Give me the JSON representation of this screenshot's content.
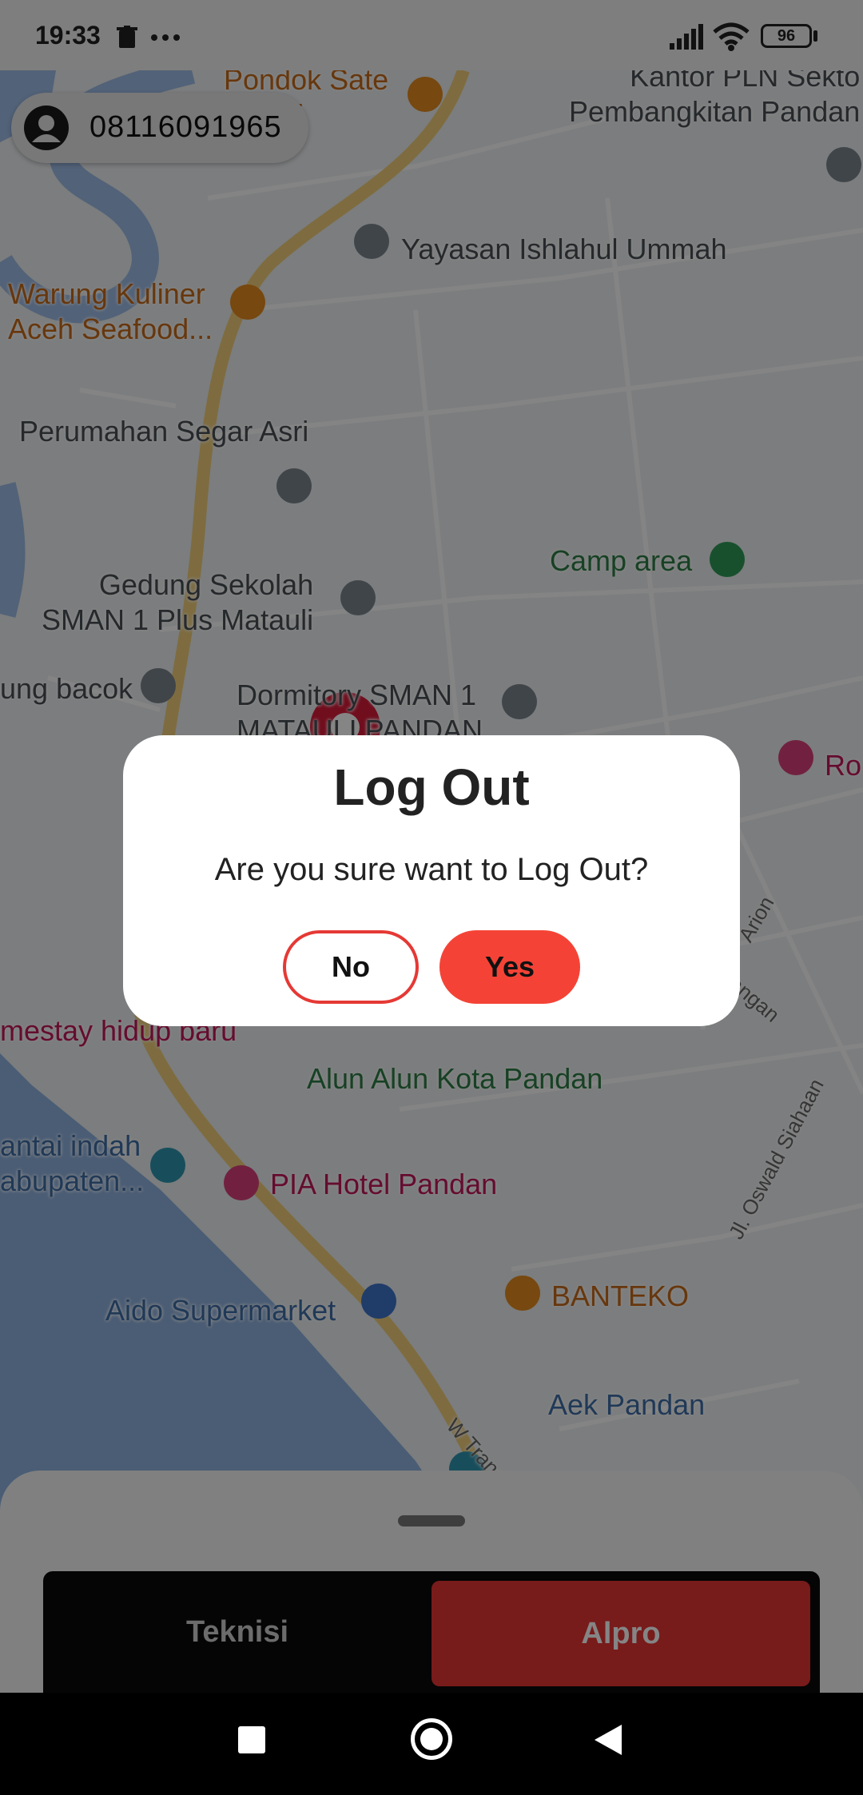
{
  "status_bar": {
    "time": "19:33",
    "battery": "96",
    "icons": [
      "trash-icon",
      "more-dots-icon",
      "signal-icon",
      "wifi-icon",
      "battery-icon"
    ]
  },
  "user": {
    "phone": "08116091965",
    "icon": "account-circle-icon"
  },
  "map": {
    "labels": {
      "pondok_sate": "Pondok Sate\nSubali",
      "kantor_pln": "Kantor PLN Sekto\nPembangkitan Pandan",
      "yayasan": "Yayasan Ishlahul Ummah",
      "warung_kuliner": "Warung Kuliner\nAceh Seafood...",
      "perumahan": "Perumahan Segar Asri",
      "camp_area": "Camp area",
      "gedung_sekolah": "Gedung Sekolah\nSMAN 1 Plus Matauli",
      "ung_bacok": "ung bacok",
      "dormitory": "Dormitory SMAN 1\nMATAULI PANDAN",
      "ro": "Ro",
      "homestay": "mestay hidup baru",
      "alun_alun": "Alun Alun Kota Pandan",
      "pantai": "antai indah\nabupaten...",
      "pia_hotel": "PIA Hotel Pandan",
      "aido": "Aido Supermarket",
      "banteko": "BANTEKO",
      "aek_pandan": "Aek Pandan",
      "road_arion": "Arion",
      "road_angan": "angan",
      "road_oswald": "Jl. Oswald Siahaan",
      "road_trans": "W Trans S"
    }
  },
  "dialog": {
    "title": "Log Out",
    "message": "Are you sure want to Log Out?",
    "no_label": "No",
    "yes_label": "Yes"
  },
  "bottom_panel": {
    "tabs": [
      {
        "label": "Teknisi",
        "active": false
      },
      {
        "label": "Alpro",
        "active": true
      }
    ],
    "accent": "#e73535"
  },
  "nav_bar": {
    "icons": [
      "recents-square-icon",
      "home-circle-icon",
      "back-triangle-icon"
    ]
  },
  "colors": {
    "primary_red": "#f44336",
    "map_water": "#7fa6d9",
    "map_road": "#f4d589"
  }
}
